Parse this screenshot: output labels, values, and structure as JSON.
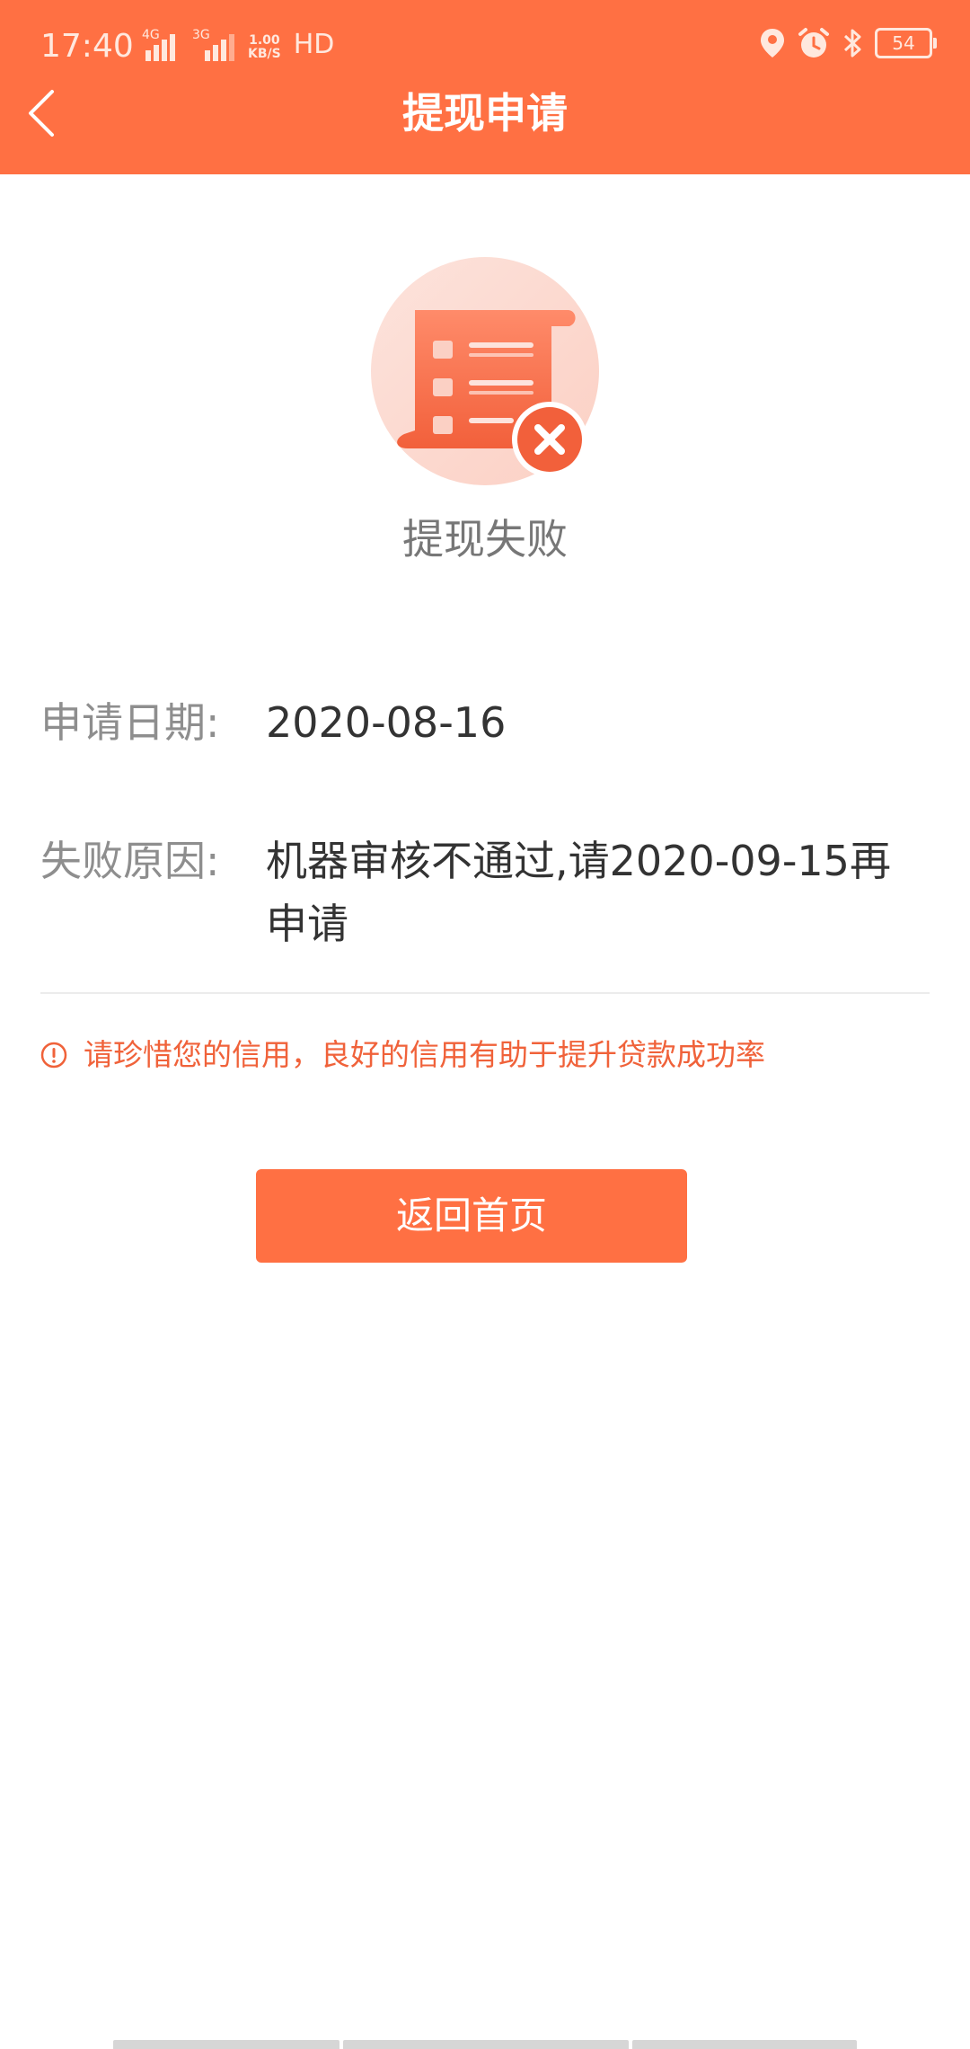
{
  "status_bar": {
    "time": "17:40",
    "network_1": "4G",
    "network_2": "3G",
    "speed_value": "1.00",
    "speed_unit": "KB/S",
    "hd": "HD",
    "battery": "54"
  },
  "header": {
    "title": "提现申请",
    "background": "#ff7043"
  },
  "result": {
    "status": "提现失败"
  },
  "details": {
    "date_label": "申请日期:",
    "date_value": "2020-08-16",
    "reason_label": "失败原因:",
    "reason_value": "机器审核不通过,请2020-09-15再申请"
  },
  "tip": {
    "text": "请珍惜您的信用，良好的信用有助于提升贷款成功率",
    "color": "#f0623a"
  },
  "action": {
    "home_button": "返回首页"
  },
  "icons": [
    "back-arrow-icon",
    "location-icon",
    "alarm-icon",
    "bluetooth-icon",
    "battery-icon",
    "document-fail-icon",
    "warning-icon"
  ]
}
